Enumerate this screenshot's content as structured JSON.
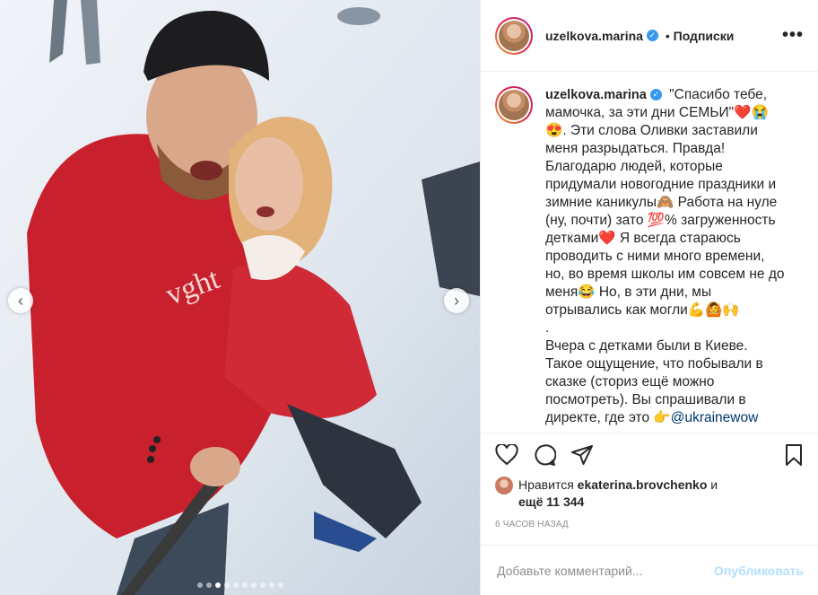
{
  "post": {
    "username": "uzelkova.marina",
    "follow_label": "Подписки",
    "more_label": "•••",
    "verified_mark": "✓"
  },
  "media": {
    "prev_label": "‹",
    "next_label": "›",
    "slides_total": 10,
    "active_slide": 3
  },
  "caption": {
    "username": "uzelkova.marina",
    "text_1": " \"Спасибо тебе, мамочка, за эти дни СЕМЬИ\"",
    "emoji_1": "❤️😭😍",
    "text_2": ". Эти слова Оливки заставили меня разрыдаться. Правда! Благодарю людей, которые придумали новогодние праздники и зимние каникулы🙈 Работа на нуле (ну, почти) зато 💯% загруженность детками",
    "emoji_2": "❤️",
    "text_3": " Я всегда стараюсь проводить с ними много времени, но, во время школы им совсем не до меня😂 Но, в эти дни, мы отрывались как могли💪🙆🙌\n.\nВчера с детками были в Киеве. Такое ощущение, что побывали в сказке (сториз ещё можно посмотреть). Вы спрашивали в директе, где это 👉",
    "mention": "@ukrainewow"
  },
  "likes": {
    "prefix": "Нравится ",
    "user": "ekaterina.brovchenko",
    "middle": " и",
    "count": "ещё 11 344"
  },
  "time_ago": "6 ЧАСОВ НАЗАД",
  "comment": {
    "placeholder": "Добавьте комментарий...",
    "publish_label": "Опубликовать"
  },
  "colors": {
    "accent_blue": "#3897f0",
    "publish_disabled": "#b2dffc",
    "heart_red": "#e02f3b"
  }
}
